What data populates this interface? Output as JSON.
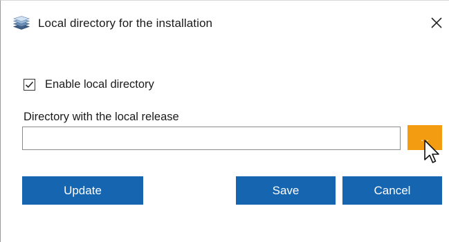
{
  "window": {
    "title": "Local directory for the installation",
    "app_icon": "stacked-layers-icon",
    "close_icon": "close-icon"
  },
  "options": {
    "enable_local_directory_label": "Enable local directory",
    "enable_local_directory_checked": true
  },
  "directory": {
    "label": "Directory with the local release",
    "value": "",
    "placeholder": "",
    "browse_label": "..."
  },
  "buttons": {
    "update": "Update",
    "save": "Save",
    "cancel": "Cancel"
  },
  "colors": {
    "primary_button": "#1565b0",
    "browse_button": "#f39c12"
  }
}
